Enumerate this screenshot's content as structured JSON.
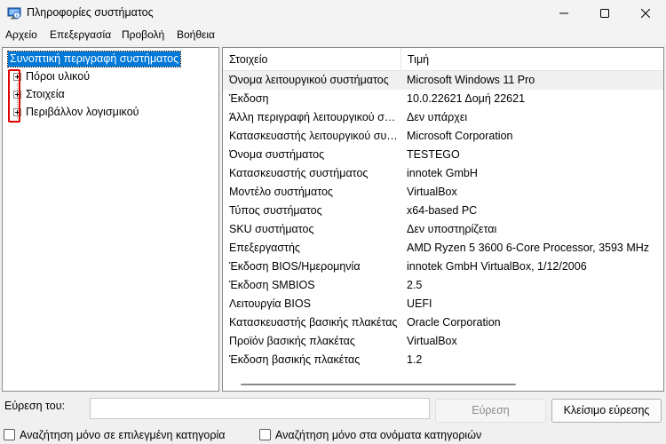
{
  "window": {
    "title": "Πληροφορίες συστήματος",
    "icon": "system-information-icon"
  },
  "menu": [
    "Αρχείο",
    "Επεξεργασία",
    "Προβολή",
    "Βοήθεια"
  ],
  "tree": {
    "root": "Συνοπτική περιγραφή συστήματος",
    "children": [
      "Πόροι υλικού",
      "Στοιχεία",
      "Περιβάλλον λογισμικού"
    ]
  },
  "list": {
    "columns": [
      "Στοιχείο",
      "Τιμή"
    ],
    "rows": [
      {
        "item": "Όνομα λειτουργικού συστήματος",
        "value": "Microsoft Windows 11 Pro"
      },
      {
        "item": "Έκδοση",
        "value": "10.0.22621 Δομή 22621"
      },
      {
        "item": "Άλλη περιγραφή λειτουργικού συστήματος",
        "value": "Δεν υπάρχει"
      },
      {
        "item": "Κατασκευαστής λειτουργικού συστήματος",
        "value": "Microsoft Corporation"
      },
      {
        "item": "Όνομα συστήματος",
        "value": "TESTEGO"
      },
      {
        "item": "Κατασκευαστής συστήματος",
        "value": "innotek GmbH"
      },
      {
        "item": "Μοντέλο συστήματος",
        "value": "VirtualBox"
      },
      {
        "item": "Τύπος συστήματος",
        "value": "x64-based PC"
      },
      {
        "item": "SKU συστήματος",
        "value": "Δεν υποστηρίζεται"
      },
      {
        "item": "Επεξεργαστής",
        "value": "AMD Ryzen 5 3600 6-Core Processor, 3593 MHz"
      },
      {
        "item": "Έκδοση BIOS/Ημερομηνία",
        "value": "innotek GmbH VirtualBox, 1/12/2006"
      },
      {
        "item": "Έκδοση SMBIOS",
        "value": "2.5"
      },
      {
        "item": "Λειτουργία BIOS",
        "value": "UEFI"
      },
      {
        "item": "Κατασκευαστής βασικής πλακέτας",
        "value": "Oracle Corporation"
      },
      {
        "item": "Προϊόν βασικής πλακέτας",
        "value": "VirtualBox"
      },
      {
        "item": "Έκδοση βασικής πλακέτας",
        "value": "1.2"
      }
    ]
  },
  "find": {
    "label": "Εύρεση του:",
    "value": "",
    "find_button": "Εύρεση",
    "close_button": "Κλείσιμο εύρεσης",
    "check_selected_category": "Αναζήτηση μόνο σε επιλεγμένη κατηγορία",
    "check_category_names": "Αναζήτηση μόνο στα ονόματα κατηγοριών"
  }
}
